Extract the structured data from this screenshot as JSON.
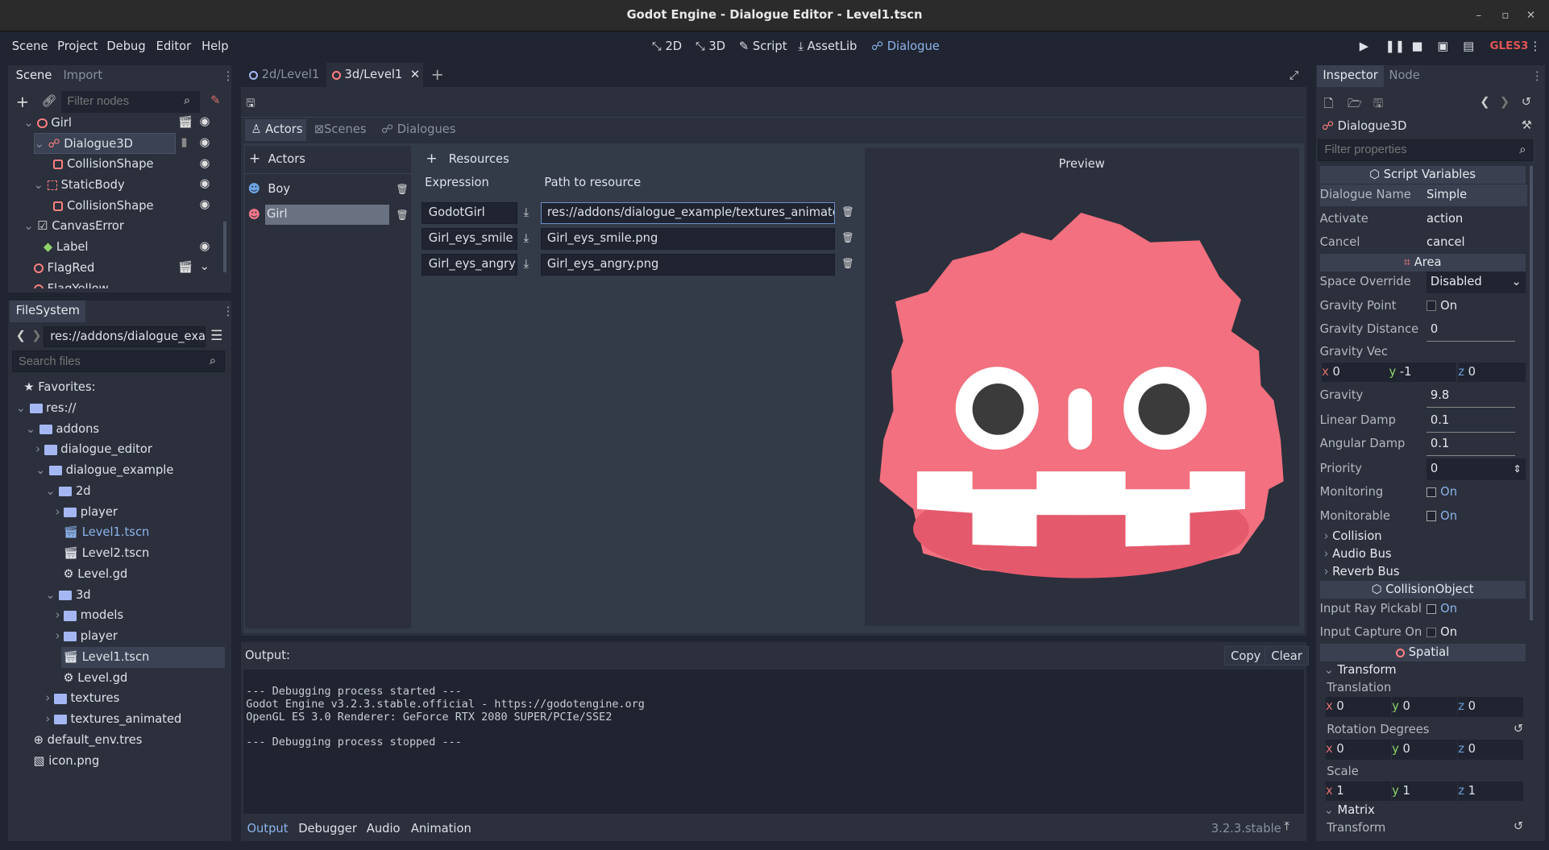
{
  "window": {
    "title": "Godot Engine - Dialogue Editor - Level1.tscn"
  },
  "menu": [
    "Scene",
    "Project",
    "Debug",
    "Editor",
    "Help"
  ],
  "workspaces": [
    "2D",
    "3D",
    "Script",
    "AssetLib",
    "Dialogue"
  ],
  "renderer": "GLES3",
  "scene_dock": {
    "tabs": [
      "Scene",
      "Import"
    ],
    "filter_placeholder": "Filter nodes",
    "nodes": [
      {
        "label": "Girl"
      },
      {
        "label": "Dialogue3D"
      },
      {
        "label": "CollisionShape"
      },
      {
        "label": "StaticBody"
      },
      {
        "label": "CollisionShape"
      },
      {
        "label": "CanvasError"
      },
      {
        "label": "Label"
      },
      {
        "label": "FlagRed"
      },
      {
        "label": "FlagYellow"
      }
    ]
  },
  "filesystem": {
    "tab": "FileSystem",
    "path": "res://addons/dialogue_exa",
    "search_placeholder": "Search files",
    "items": [
      "Favorites:",
      "res://",
      "addons",
      "dialogue_editor",
      "dialogue_example",
      "2d",
      "player",
      "Level1.tscn",
      "Level2.tscn",
      "Level.gd",
      "3d",
      "models",
      "player",
      "Level1.tscn",
      "Level.gd",
      "textures",
      "textures_animated",
      "default_env.tres",
      "icon.png"
    ]
  },
  "scene_tabs": [
    "2d/Level1",
    "3d/Level1"
  ],
  "dialogue": {
    "tabs": [
      "Actors",
      "Scenes",
      "Dialogues"
    ],
    "actors_label": "Actors",
    "actors": [
      "Boy",
      "Girl"
    ],
    "resources_label": "Resources",
    "col_expression": "Expression",
    "col_path": "Path to resource",
    "resources": [
      {
        "expression": "GodotGirl",
        "path": "res://addons/dialogue_example/textures_animated"
      },
      {
        "expression": "Girl_eys_smile",
        "path": "Girl_eys_smile.png"
      },
      {
        "expression": "Girl_eys_angry",
        "path": "Girl_eys_angry.png"
      }
    ],
    "preview_label": "Preview"
  },
  "output": {
    "title": "Output:",
    "copy": "Copy",
    "clear": "Clear",
    "lines": [
      "--- Debugging process started ---",
      "Godot Engine v3.2.3.stable.official - https://godotengine.org",
      "OpenGL ES 3.0 Renderer: GeForce RTX 2080 SUPER/PCIe/SSE2",
      "",
      "--- Debugging process stopped ---"
    ]
  },
  "bottom_tabs": [
    "Output",
    "Debugger",
    "Audio",
    "Animation"
  ],
  "version": "3.2.3.stable",
  "inspector": {
    "tabs": [
      "Inspector",
      "Node"
    ],
    "node_name": "Dialogue3D",
    "filter_placeholder": "Filter properties",
    "sections": {
      "script_vars": "Script Variables",
      "area": "Area",
      "collision_object": "CollisionObject",
      "spatial": "Spatial"
    },
    "props": {
      "dialogue_name": {
        "k": "Dialogue Name",
        "v": "Simple"
      },
      "activate": {
        "k": "Activate",
        "v": "action"
      },
      "cancel": {
        "k": "Cancel",
        "v": "cancel"
      },
      "space_override": {
        "k": "Space Override",
        "v": "Disabled"
      },
      "gravity_point": {
        "k": "Gravity Point",
        "v": "On"
      },
      "gravity_distance": {
        "k": "Gravity Distance S",
        "v": "0"
      },
      "gravity_vec": {
        "k": "Gravity Vec",
        "x": "0",
        "y": "-1",
        "z": "0"
      },
      "gravity": {
        "k": "Gravity",
        "v": "9.8"
      },
      "linear_damp": {
        "k": "Linear Damp",
        "v": "0.1"
      },
      "angular_damp": {
        "k": "Angular Damp",
        "v": "0.1"
      },
      "priority": {
        "k": "Priority",
        "v": "0"
      },
      "monitoring": {
        "k": "Monitoring",
        "v": "On"
      },
      "monitorable": {
        "k": "Monitorable",
        "v": "On"
      },
      "input_ray": {
        "k": "Input Ray Pickabl",
        "v": "On"
      },
      "input_capture": {
        "k": "Input Capture On",
        "v": "On"
      }
    },
    "groups": [
      "Collision",
      "Audio Bus",
      "Reverb Bus"
    ],
    "transform": {
      "label": "Transform",
      "translation": {
        "k": "Translation",
        "x": "0",
        "y": "0",
        "z": "0"
      },
      "rotation": {
        "k": "Rotation Degrees",
        "x": "0",
        "y": "0",
        "z": "0"
      },
      "scale": {
        "k": "Scale",
        "x": "1",
        "y": "1",
        "z": "1"
      },
      "matrix": "Matrix",
      "matrix_transform": "Transform"
    }
  }
}
